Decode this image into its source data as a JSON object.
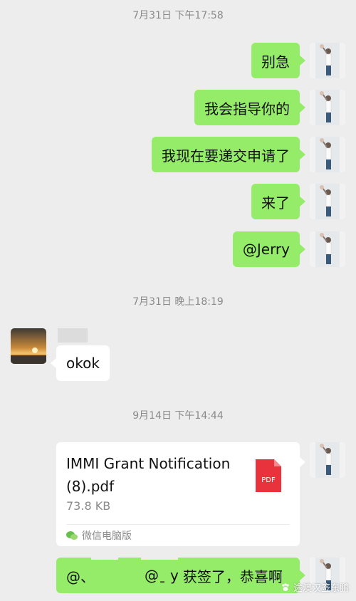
{
  "chat": {
    "timestamps": [
      "7月31日 下午17:58",
      "7月31日 晚上18:19",
      "9月14日 下午14:44"
    ],
    "outgoing": [
      "别急",
      "我会指导你的",
      "我现在要递交申请了",
      "来了",
      "@Jerry"
    ],
    "incoming": {
      "text": "okok"
    },
    "file": {
      "name": "IMMI Grant Notification (8).pdf",
      "size": "73.8 KB",
      "source": "微信电脑版",
      "type_label": "PDF"
    },
    "last_message": {
      "prefix_a": "@、",
      "prefix_b": "@ˍ",
      "prefix_c": "y",
      "text": "获签了，恭喜啊"
    }
  },
  "watermark": "途澳汉签东鹏",
  "colors": {
    "outgoing_bubble": "#95ec69",
    "incoming_bubble": "#ffffff",
    "background": "#ededed",
    "pdf_red": "#e8323c"
  }
}
